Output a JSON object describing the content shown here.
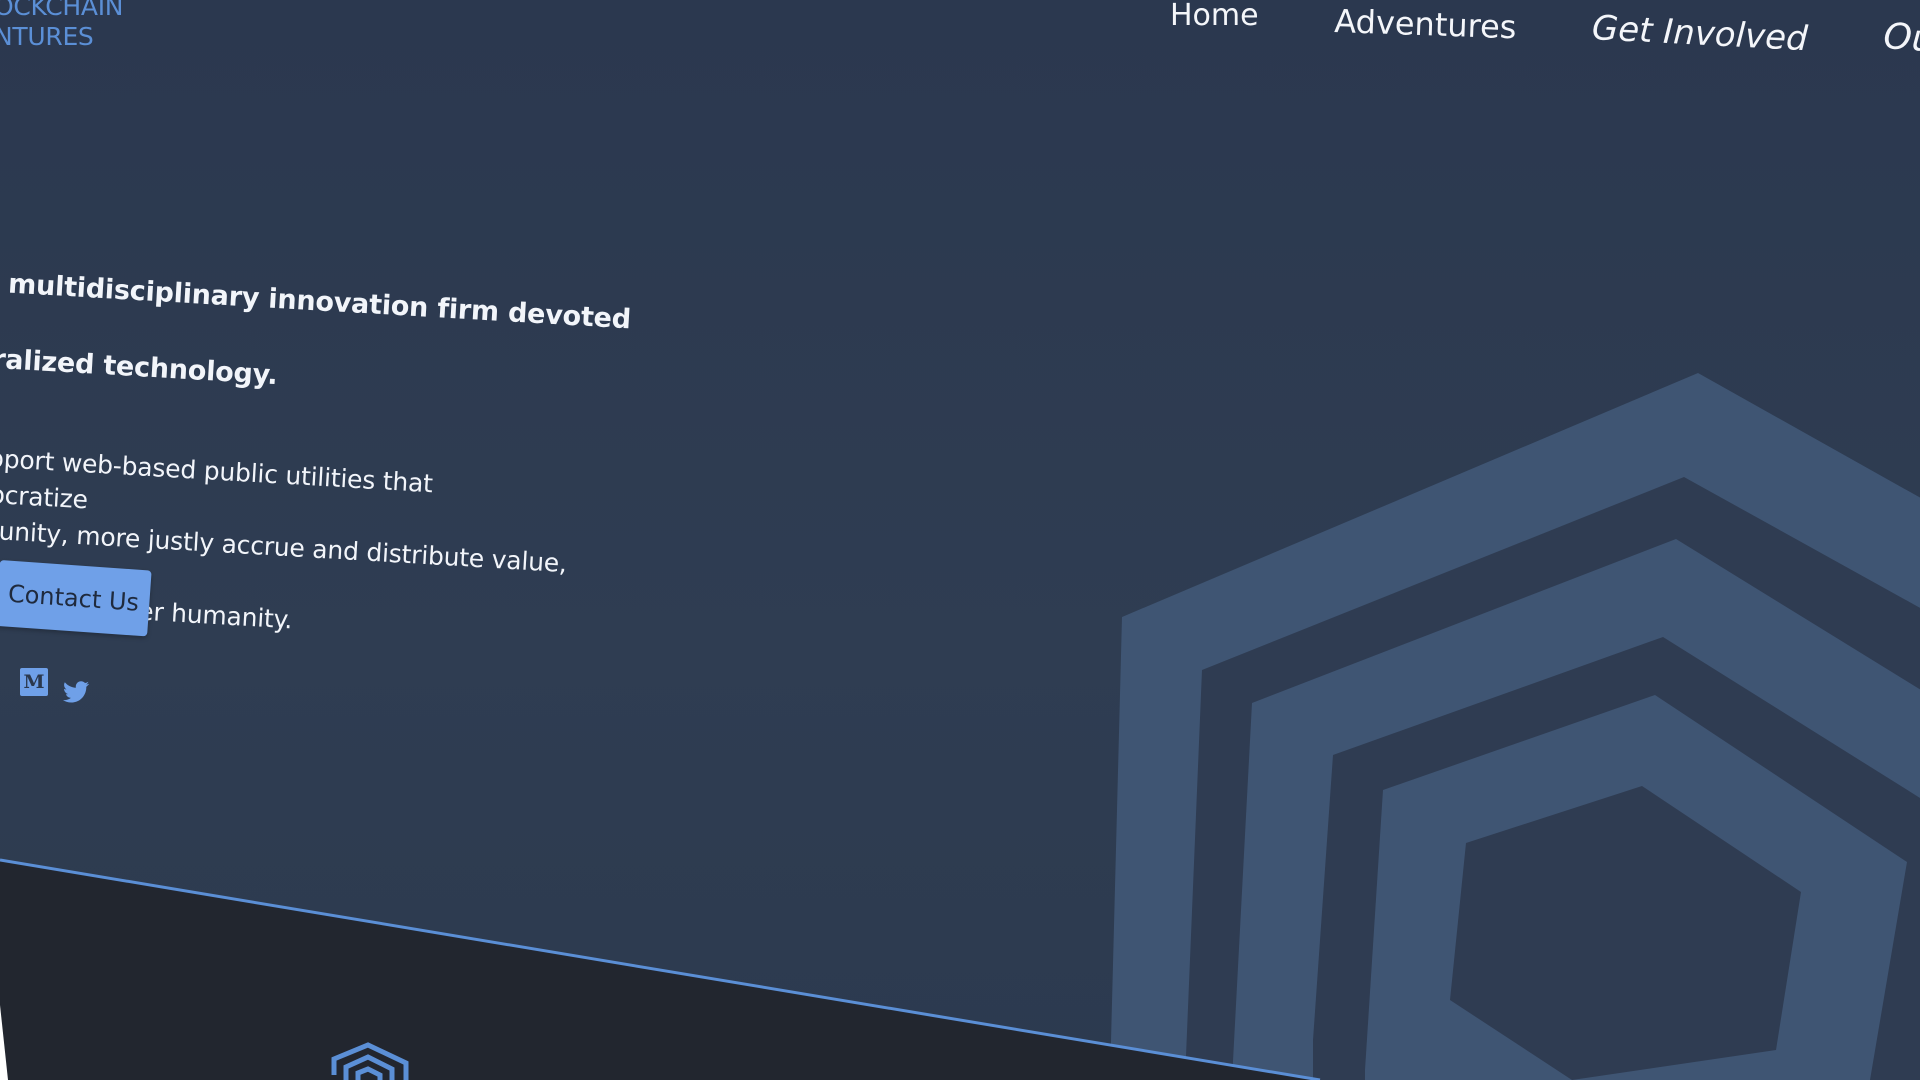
{
  "logo": {
    "line1": "OCKCHAIN",
    "line2": "NTURES"
  },
  "nav": {
    "home": "Home",
    "adventures": "Adventures",
    "get_involved": "Get Involved",
    "our": "Ou"
  },
  "hero": {
    "lead_line1": "is a multidisciplinary innovation firm devoted to",
    "lead_line2": "entralized technology.",
    "body_line1": "e support web-based public utilities that democratize",
    "body_line2": "pportunity, more justly accrue and distribute value, and",
    "body_line3": "romote our greater humanity.",
    "cta_label": "Contact Us"
  },
  "social": {
    "medium_glyph": "M",
    "twitter_icon": "twitter-icon"
  },
  "colors": {
    "background": "#2e3c51",
    "accent": "#6fa0e8",
    "hex_light": "#3f5573",
    "footer": "#22262f"
  }
}
